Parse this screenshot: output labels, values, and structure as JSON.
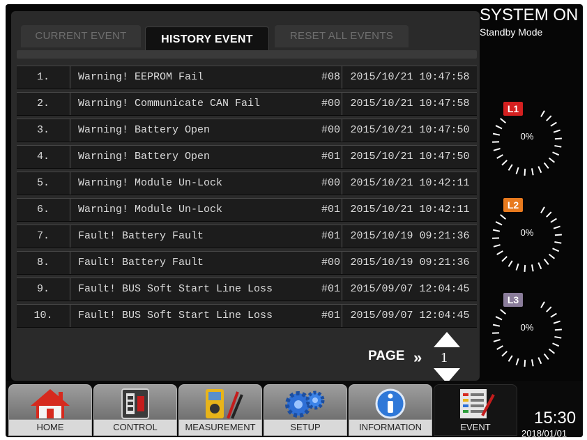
{
  "tabs": [
    {
      "label": "CURRENT EVENT",
      "active": false
    },
    {
      "label": "HISTORY EVENT",
      "active": true
    },
    {
      "label": "RESET ALL EVENTS",
      "active": false
    }
  ],
  "events": [
    {
      "num": "1.",
      "message": "Warning! EEPROM Fail",
      "code": "#08",
      "time": "2015/10/21 10:47:58"
    },
    {
      "num": "2.",
      "message": "Warning! Communicate CAN Fail",
      "code": "#00",
      "time": "2015/10/21 10:47:58"
    },
    {
      "num": "3.",
      "message": "Warning! Battery Open",
      "code": "#00",
      "time": "2015/10/21 10:47:50"
    },
    {
      "num": "4.",
      "message": "Warning! Battery Open",
      "code": "#01",
      "time": "2015/10/21 10:47:50"
    },
    {
      "num": "5.",
      "message": "Warning! Module Un-Lock",
      "code": "#00",
      "time": "2015/10/21 10:42:11"
    },
    {
      "num": "6.",
      "message": "Warning! Module Un-Lock",
      "code": "#01",
      "time": "2015/10/21 10:42:11"
    },
    {
      "num": "7.",
      "message": "Fault! Battery Fault",
      "code": "#01",
      "time": "2015/10/19 09:21:36"
    },
    {
      "num": "8.",
      "message": "Fault! Battery Fault",
      "code": "#00",
      "time": "2015/10/19 09:21:36"
    },
    {
      "num": "9.",
      "message": "Fault! BUS Soft Start Line Loss",
      "code": "#01",
      "time": "2015/09/07 12:04:45"
    },
    {
      "num": "10.",
      "message": "Fault! BUS Soft Start Line Loss",
      "code": "#01",
      "time": "2015/09/07 12:04:45"
    }
  ],
  "pager": {
    "label": "PAGE",
    "arrows": "»",
    "page": "1"
  },
  "status": {
    "system": "SYSTEM ON",
    "mode": "Standby Mode"
  },
  "gauges": [
    {
      "label": "L1",
      "value": "0%",
      "color": "#d42020"
    },
    {
      "label": "L2",
      "value": "0%",
      "color": "#e87a1e"
    },
    {
      "label": "L3",
      "value": "0%",
      "color": "#8a7c9a"
    }
  ],
  "nav": [
    {
      "label": "HOME",
      "icon": "home-icon"
    },
    {
      "label": "CONTROL",
      "icon": "control-icon"
    },
    {
      "label": "MEASUREMENT",
      "icon": "multimeter-icon"
    },
    {
      "label": "SETUP",
      "icon": "gears-icon"
    },
    {
      "label": "INFORMATION",
      "icon": "info-icon"
    },
    {
      "label": "EVENT",
      "icon": "event-log-icon"
    }
  ],
  "clock": {
    "time": "15:30",
    "date": "2018/01/01"
  }
}
